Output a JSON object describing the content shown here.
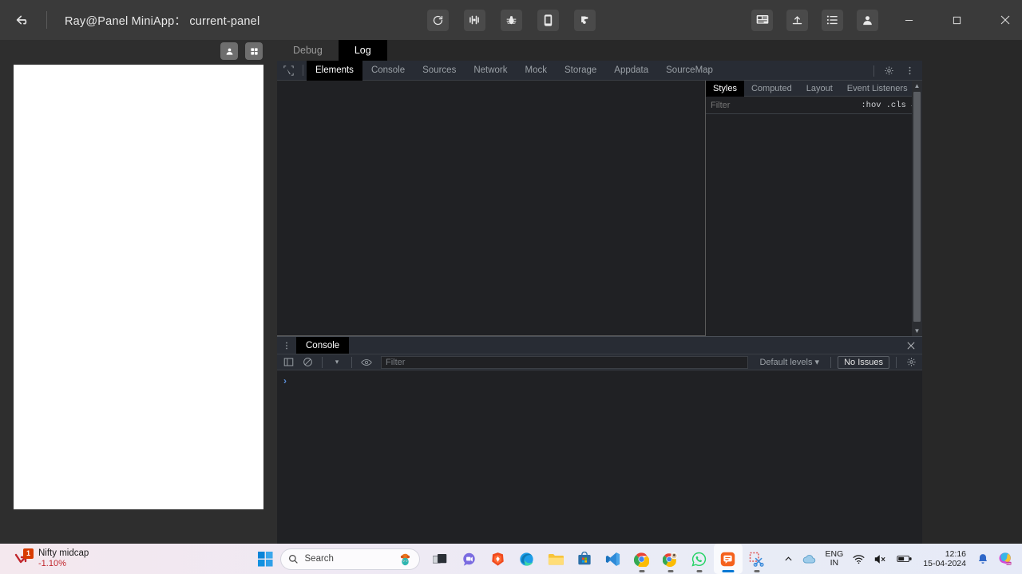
{
  "titlebar": {
    "back_icon": "back-arrow-icon",
    "title": "Ray@Panel MiniApp： current-panel",
    "center_buttons": [
      {
        "name": "refresh-button",
        "icon": "refresh-icon"
      },
      {
        "name": "compile-button",
        "icon": "compile-icon"
      },
      {
        "name": "debug-bug-button",
        "icon": "bug-icon"
      },
      {
        "name": "device-preview-button",
        "icon": "phone-icon"
      },
      {
        "name": "settings-shape-button",
        "icon": "puzzle-icon"
      }
    ],
    "right_buttons": [
      {
        "name": "preview-monitor-button",
        "icon": "monitor-icon"
      },
      {
        "name": "upload-button",
        "icon": "upload-icon"
      },
      {
        "name": "menu-list-button",
        "icon": "list-icon"
      },
      {
        "name": "user-account-button",
        "icon": "user-icon"
      }
    ],
    "window_controls": {
      "minimize": "minimize-icon",
      "maximize": "maximize-icon",
      "close": "close-icon"
    }
  },
  "simulator": {
    "tools": [
      {
        "name": "simulator-user-button",
        "icon": "user-icon"
      },
      {
        "name": "simulator-grid-button",
        "icon": "grid-icon"
      }
    ],
    "screen_background": "#ffffff"
  },
  "panel_tabs": [
    {
      "label": "Debug",
      "active": false
    },
    {
      "label": "Log",
      "active": true
    }
  ],
  "devtools": {
    "inspect_icon": "inspect-element-icon",
    "tabs": [
      {
        "label": "Elements",
        "active": true
      },
      {
        "label": "Console",
        "active": false
      },
      {
        "label": "Sources",
        "active": false
      },
      {
        "label": "Network",
        "active": false
      },
      {
        "label": "Mock",
        "active": false
      },
      {
        "label": "Storage",
        "active": false
      },
      {
        "label": "Appdata",
        "active": false
      },
      {
        "label": "SourceMap",
        "active": false
      }
    ],
    "toolbar_right": [
      {
        "name": "devtools-settings-button",
        "icon": "gear-icon"
      },
      {
        "name": "devtools-more-button",
        "icon": "vertical-dots-icon"
      }
    ],
    "styles": {
      "tabs": [
        {
          "label": "Styles",
          "active": true
        },
        {
          "label": "Computed",
          "active": false
        },
        {
          "label": "Layout",
          "active": false
        },
        {
          "label": "Event Listeners",
          "active": false
        }
      ],
      "overflow_label": "»",
      "filter_placeholder": "Filter",
      "hov_label": ":hov",
      "cls_label": ".cls",
      "new_rule_label": "+"
    },
    "drawer": {
      "more_icon": "vertical-dots-icon",
      "tab_label": "Console",
      "close_icon": "close-icon",
      "toolbar": {
        "sidebar_icon": "sidebar-toggle-icon",
        "clear_icon": "clear-console-icon",
        "context_dropdown": "▾",
        "eye_icon": "eye-icon",
        "filter_placeholder": "Filter",
        "levels_label": "Default levels",
        "levels_caret": "▾",
        "issues_label": "No Issues",
        "settings_icon": "gear-icon"
      },
      "prompt_symbol": "›"
    }
  },
  "taskbar": {
    "widget": {
      "badge_count": "1",
      "title": "Nifty midcap",
      "change": "-1.10%",
      "change_color": "#c1272d"
    },
    "start_button": "start-icon",
    "search": {
      "icon": "search-icon",
      "placeholder": "Search"
    },
    "apps": [
      {
        "name": "task-view-icon",
        "label": "Task View",
        "active": false
      },
      {
        "name": "teams-chat-icon",
        "label": "Chat",
        "active": false
      },
      {
        "name": "brave-browser-icon",
        "label": "Brave",
        "active": false
      },
      {
        "name": "edge-browser-icon",
        "label": "Microsoft Edge",
        "active": false
      },
      {
        "name": "file-explorer-icon",
        "label": "File Explorer",
        "active": false
      },
      {
        "name": "microsoft-store-icon",
        "label": "Microsoft Store",
        "active": false
      },
      {
        "name": "vscode-icon",
        "label": "Visual Studio Code",
        "active": false
      },
      {
        "name": "chrome-icon",
        "label": "Google Chrome",
        "active": false
      },
      {
        "name": "chrome-profile-icon",
        "label": "Google Chrome",
        "active": false
      },
      {
        "name": "whatsapp-icon",
        "label": "WhatsApp",
        "active": false
      },
      {
        "name": "ray-panel-icon",
        "label": "Ray Panel",
        "active": true
      },
      {
        "name": "snipping-tool-icon",
        "label": "Snipping Tool",
        "active": false
      }
    ],
    "tray": {
      "overflow_icon": "chevron-up-icon",
      "onedrive_icon": "cloud-icon",
      "language_line1": "ENG",
      "language_line2": "IN",
      "wifi_icon": "wifi-icon",
      "volume_icon": "volume-muted-icon",
      "battery_icon": "battery-icon",
      "time": "12:16",
      "date": "15-04-2024",
      "notification_icon": "bell-icon",
      "copilot_icon": "copilot-icon",
      "copilot_badge": "PRE"
    }
  }
}
